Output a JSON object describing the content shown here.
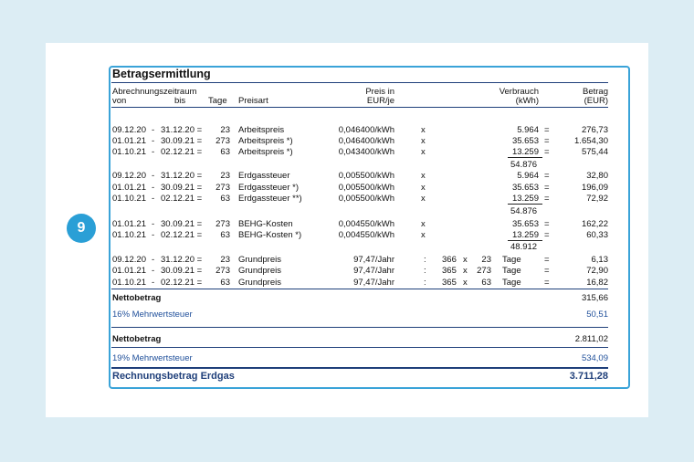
{
  "badge": "9",
  "title": "Betragsermittlung",
  "header": {
    "period": "Abrechnungszeitraum",
    "von": "von",
    "bis": "bis",
    "tage": "Tage",
    "preisart": "Preisart",
    "preis1": "Preis in",
    "preis2": "EUR/je",
    "verbrauch1": "Verbrauch",
    "verbrauch2": "(kWh)",
    "betrag1": "Betrag",
    "betrag2": "(EUR)"
  },
  "rows": [
    {
      "from": "09.12.20",
      "to": "31.12.20 =",
      "days": "23",
      "type": "Arbeitspreis",
      "price": "0,046400/kWh",
      "op": "x",
      "cons": "5.964",
      "eq": "=",
      "amount": "276,73"
    },
    {
      "from": "01.01.21",
      "to": "30.09.21 =",
      "days": "273",
      "type": "Arbeitspreis *)",
      "price": "0,046400/kWh",
      "op": "x",
      "cons": "35.653",
      "eq": "=",
      "amount": "1.654,30"
    },
    {
      "from": "01.10.21",
      "to": "02.12.21 =",
      "days": "63",
      "type": "Arbeitspreis *)",
      "price": "0,043400/kWh",
      "op": "x",
      "cons": "13.259",
      "eq": "=",
      "amount": "575,44"
    },
    {
      "from": "09.12.20",
      "to": "31.12.20 =",
      "days": "23",
      "type": "Erdgassteuer",
      "price": "0,005500/kWh",
      "op": "x",
      "cons": "5.964",
      "eq": "=",
      "amount": "32,80"
    },
    {
      "from": "01.01.21",
      "to": "30.09.21 =",
      "days": "273",
      "type": "Erdgassteuer *)",
      "price": "0,005500/kWh",
      "op": "x",
      "cons": "35.653",
      "eq": "=",
      "amount": "196,09"
    },
    {
      "from": "01.10.21",
      "to": "02.12.21 =",
      "days": "63",
      "type": "Erdgassteuer **)",
      "price": "0,005500/kWh",
      "op": "x",
      "cons": "13.259",
      "eq": "=",
      "amount": "72,92"
    },
    {
      "from": "01.01.21",
      "to": "30.09.21 =",
      "days": "273",
      "type": "BEHG-Kosten",
      "price": "0,004550/kWh",
      "op": "x",
      "cons": "35.653",
      "eq": "=",
      "amount": "162,22"
    },
    {
      "from": "01.10.21",
      "to": "02.12.21 =",
      "days": "63",
      "type": "BEHG-Kosten *)",
      "price": "0,004550/kWh",
      "op": "x",
      "cons": "13.259",
      "eq": "=",
      "amount": "60,33"
    }
  ],
  "subtotals": [
    "54.876",
    "54.876",
    "48.912"
  ],
  "grund": [
    {
      "from": "09.12.20",
      "to": "31.12.20 =",
      "days": "23",
      "type": "Grundpreis",
      "price": "97,47/Jahr",
      "colon": ":",
      "y": "366",
      "x": "x",
      "d": "23",
      "unit": "Tage",
      "eq": "=",
      "amount": "6,13"
    },
    {
      "from": "01.01.21",
      "to": "30.09.21 =",
      "days": "273",
      "type": "Grundpreis",
      "price": "97,47/Jahr",
      "colon": ":",
      "y": "365",
      "x": "x",
      "d": "273",
      "unit": "Tage",
      "eq": "=",
      "amount": "72,90"
    },
    {
      "from": "01.10.21",
      "to": "02.12.21 =",
      "days": "63",
      "type": "Grundpreis",
      "price": "97,47/Jahr",
      "colon": ":",
      "y": "365",
      "x": "x",
      "d": "63",
      "unit": "Tage",
      "eq": "=",
      "amount": "16,82"
    }
  ],
  "netto1": {
    "label": "Nettobetrag",
    "value": "315,66"
  },
  "mwst1": {
    "label": "16% Mehrwertsteuer",
    "value": "50,51"
  },
  "netto2": {
    "label": "Nettobetrag",
    "value": "2.811,02"
  },
  "mwst2": {
    "label": "19% Mehrwertsteuer",
    "value": "534,09"
  },
  "total": {
    "label": "Rechnungsbetrag Erdgas",
    "value": "3.711,28"
  }
}
